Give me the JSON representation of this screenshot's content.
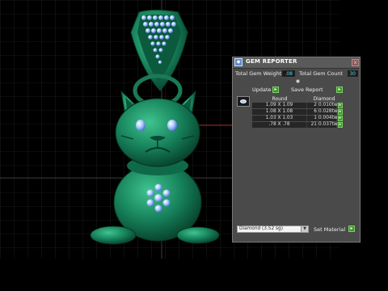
{
  "panel": {
    "title": "GEM REPORTER",
    "close_glyph": "x",
    "total_weight_label": "Total Gem Weight",
    "total_weight_value": ".08",
    "total_count_label": "Total Gem Count",
    "total_count_value": "30",
    "update_label": "Update",
    "save_report_label": "Save Report",
    "table": {
      "col_shape": "Round",
      "col_material": "Diamond",
      "rows": [
        {
          "size": "1.09 X 1.09",
          "qty": "2",
          "weight": "0.010tw"
        },
        {
          "size": "1.08 X 1.08",
          "qty": "6",
          "weight": "0.028tw"
        },
        {
          "size": "1.03 X 1.03",
          "qty": "1",
          "weight": "0.004tw"
        },
        {
          "size": ".78 X .78",
          "qty": "21",
          "weight": "0.037tw"
        }
      ]
    },
    "material_select": "Diamond   (3.52 sg)",
    "set_material_label": "Set Material"
  },
  "colors": {
    "model_green": "#1f8a63",
    "gem_blue": "#a8c8ff",
    "accent_cyan": "#4de0ff",
    "go_green": "#3c9a28"
  },
  "icons": {
    "title": "gem-reporter-icon",
    "close": "close-icon",
    "go": "green-arrow-icon",
    "gem_shape": "round-gem-icon",
    "dropdown": "chevron-down-icon"
  }
}
